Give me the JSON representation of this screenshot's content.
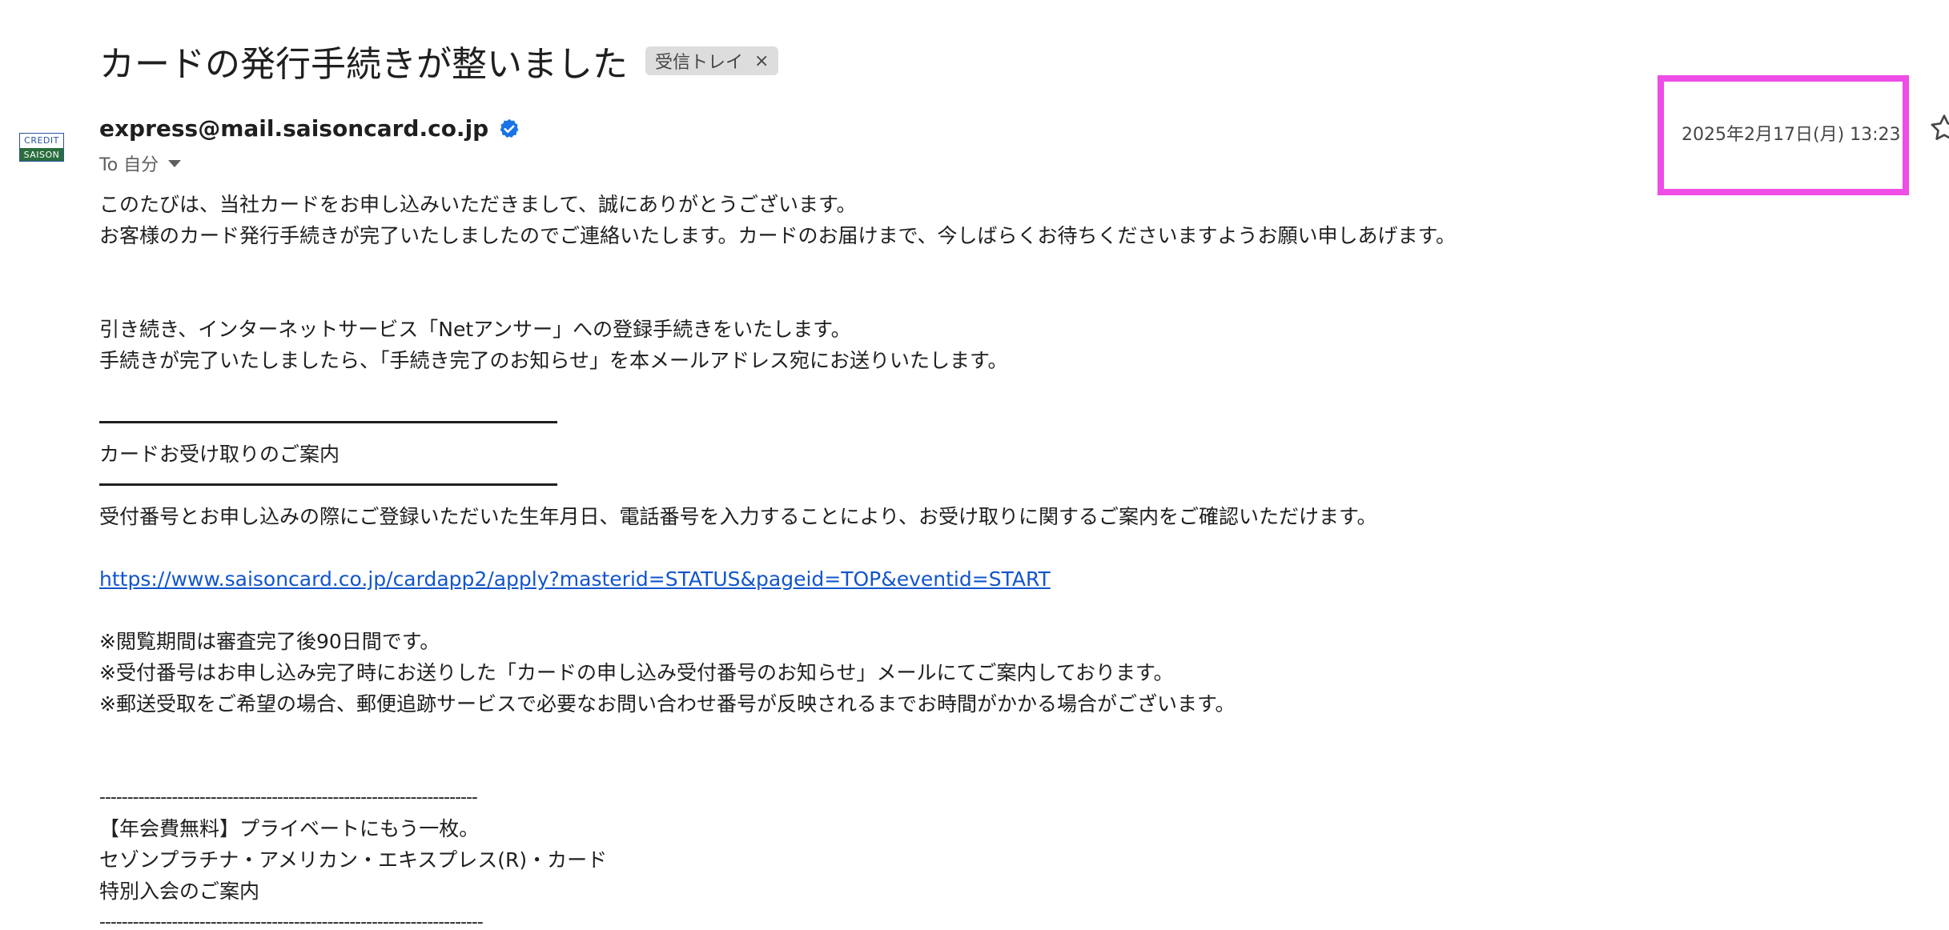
{
  "email": {
    "subject": "カードの発行手続きが整いました",
    "label_chip": "受信トレイ",
    "label_close": "×",
    "avatar": {
      "top": "CREDIT",
      "bottom": "SAISON"
    },
    "sender": "express@mail.saisoncard.co.jp",
    "to": "To 自分",
    "date": "2025年2月17日(月) 13:23"
  },
  "body": {
    "line1": "このたびは、当社カードをお申し込みいただきまして、誠にありがとうございます。",
    "line2": "お客様のカード発行手続きが完了いたしましたのでご連絡いたします。カードのお届けまで、今しばらくお待ちくださいますようお願い申しあげます。",
    "line3": "引き続き、インターネットサービス「Netアンサー」への登録手続きをいたします。",
    "line4": "手続きが完了いたしましたら、「手続き完了のお知らせ」を本メールアドレス宛にお送りいたします。",
    "section_title": "カードお受け取りのご案内",
    "line5": "受付番号とお申し込みの際にご登録いただいた生年月日、電話番号を入力することにより、お受け取りに関するご案内をご確認いただけます。",
    "link": "https://www.saisoncard.co.jp/cardapp2/apply?masterid=STATUS&pageid=TOP&eventid=START",
    "note1": "※閲覧期間は審査完了後90日間です。",
    "note2": "※受付番号はお申し込み完了時にお送りした「カードの申し込み受付番号のお知らせ」メールにてご案内しております。",
    "note3": "※郵送受取をご希望の場合、郵便追跡サービスで必要なお問い合わせ番号が反映されるまでお時間がかかる場合がございます。",
    "dash_line": "--------------------------------------------------------------------",
    "promo1": "【年会費無料】プライベートにもう一枚。",
    "promo2": "セゾンプラチナ・アメリカン・エキスプレス(R)・カード",
    "promo3": "特別入会のご案内",
    "dash_line2": "---------------------------------------------------------------------"
  },
  "colors": {
    "highlight": "#ee4de6",
    "link": "#1155cc",
    "verified": "#1a73e8"
  },
  "icons": [
    "verified-badge-icon",
    "chevron-down-icon",
    "star-icon",
    "close-icon"
  ]
}
